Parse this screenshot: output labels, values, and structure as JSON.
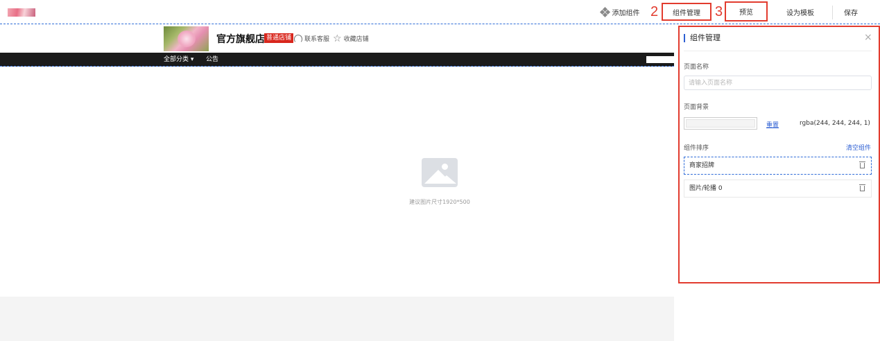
{
  "toolbar": {
    "add_component_label": "添加组件",
    "component_manage_label": "组件管理",
    "preview_label": "预览",
    "set_template_label": "设为模板",
    "save_label": "保存",
    "annotation_2": "2",
    "annotation_3": "3",
    "annotation_color": "#e23b2e"
  },
  "shop": {
    "name": "官方旗舰店",
    "badge": "普通店铺",
    "contact_service": "联系客服",
    "favorite_shop": "收藏店铺",
    "nav": {
      "all_categories": "全部分类 ▾",
      "notice": "公告"
    },
    "banner_hint": "建议图片尺寸1920*500"
  },
  "panel": {
    "title": "组件管理",
    "close_icon": "×",
    "page_name_label": "页面名称",
    "page_name_placeholder": "请输入页面名称",
    "page_name_value": "",
    "page_bg_label": "页面背景",
    "bg_color_value": "rgba(244, 244, 244, 1)",
    "reset_label": "重置",
    "sort_label": "组件排序",
    "clear_label": "清空组件",
    "components": [
      {
        "label": "商家招牌",
        "active": true
      },
      {
        "label": "图片/轮播 0",
        "active": false
      }
    ],
    "accent_color": "#2d5fd3"
  }
}
